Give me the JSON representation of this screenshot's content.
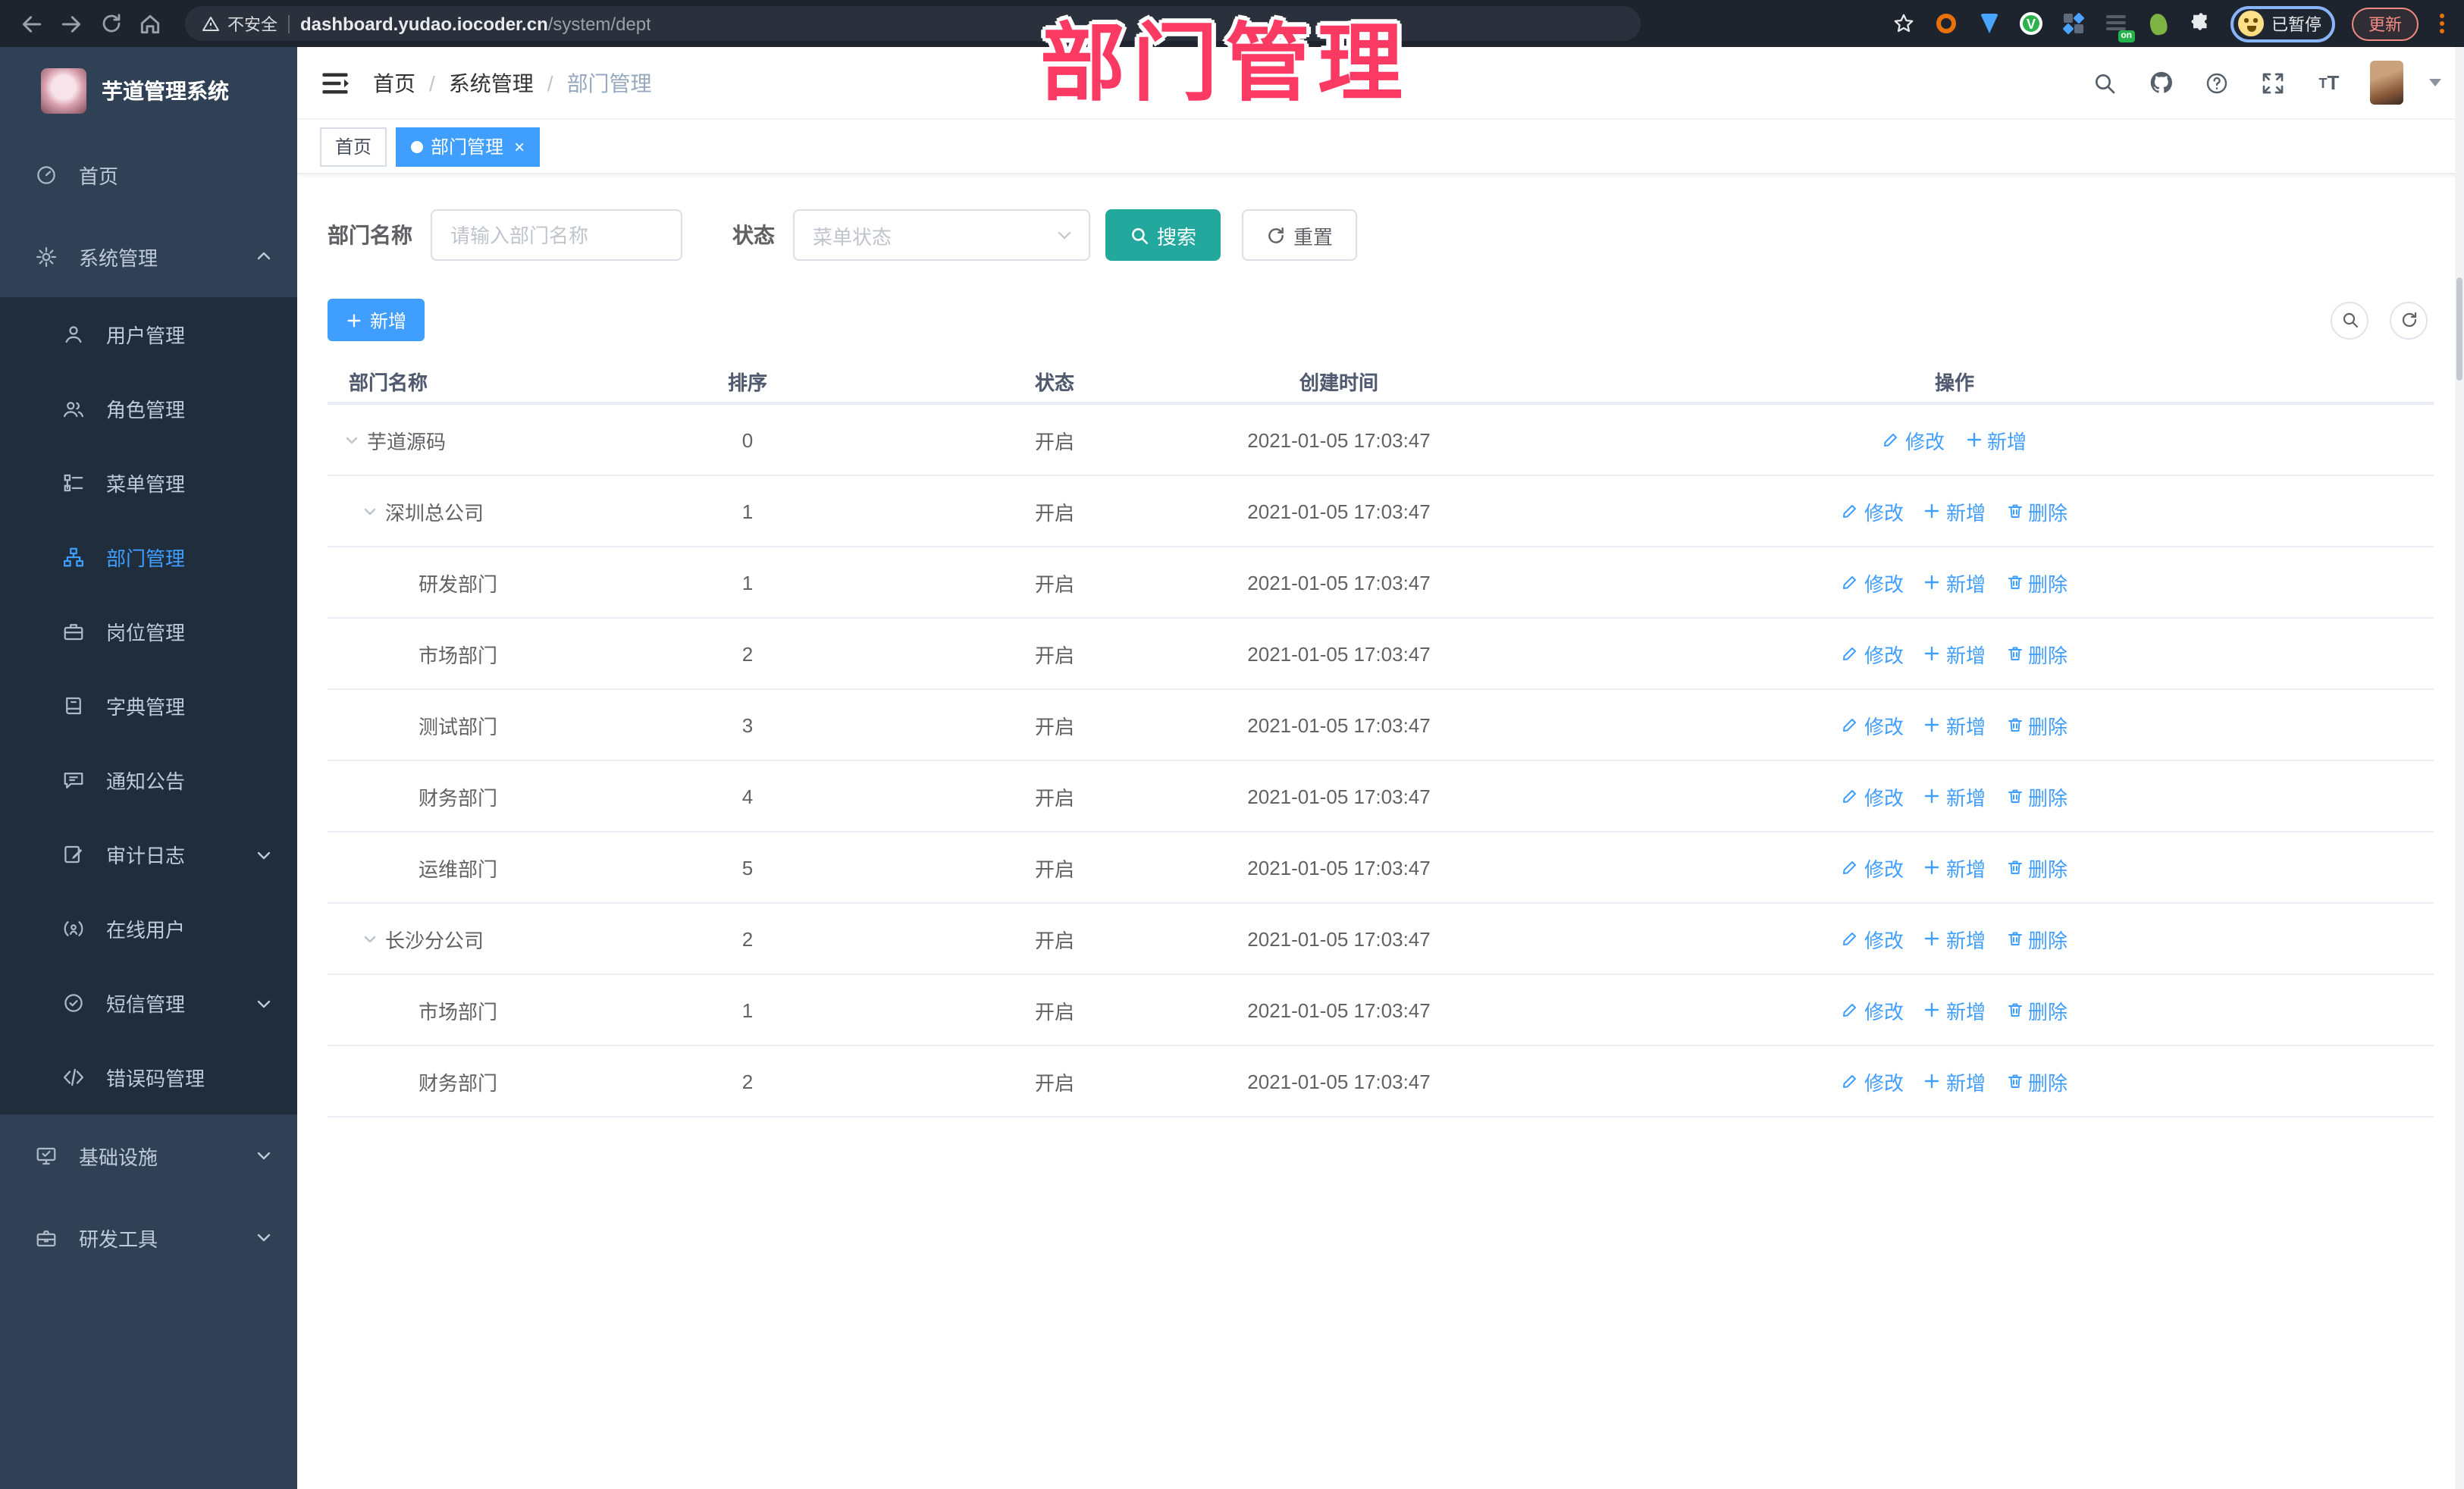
{
  "browser": {
    "security_label": "不安全",
    "url_domain": "dashboard.yudao.iocoder.cn",
    "url_path": "/system/dept",
    "extension_badge": "on",
    "profile_label": "已暂停",
    "update_label": "更新"
  },
  "watermark": "部门管理",
  "sidebar": {
    "title": "芋道管理系统",
    "items": [
      {
        "label": "首页"
      },
      {
        "label": "系统管理"
      },
      {
        "label": "用户管理"
      },
      {
        "label": "角色管理"
      },
      {
        "label": "菜单管理"
      },
      {
        "label": "部门管理"
      },
      {
        "label": "岗位管理"
      },
      {
        "label": "字典管理"
      },
      {
        "label": "通知公告"
      },
      {
        "label": "审计日志"
      },
      {
        "label": "在线用户"
      },
      {
        "label": "短信管理"
      },
      {
        "label": "错误码管理"
      },
      {
        "label": "基础设施"
      },
      {
        "label": "研发工具"
      }
    ]
  },
  "header": {
    "breadcrumb": [
      "首页",
      "系统管理",
      "部门管理"
    ]
  },
  "tabs": [
    {
      "label": "首页"
    },
    {
      "label": "部门管理"
    }
  ],
  "filters": {
    "dept_name_label": "部门名称",
    "dept_name_placeholder": "请输入部门名称",
    "status_label": "状态",
    "status_placeholder": "菜单状态",
    "search_label": "搜索",
    "reset_label": "重置"
  },
  "toolbar": {
    "add_label": "新增"
  },
  "table": {
    "columns": [
      "部门名称",
      "排序",
      "状态",
      "创建时间",
      "操作"
    ],
    "action_labels": {
      "edit": "修改",
      "add": "新增",
      "delete": "删除"
    },
    "rows": [
      {
        "name": "芋道源码",
        "level": 0,
        "caret": true,
        "sort": "0",
        "status": "开启",
        "time": "2021-01-05 17:03:47",
        "actions": [
          "edit",
          "add"
        ]
      },
      {
        "name": "深圳总公司",
        "level": 1,
        "caret": true,
        "sort": "1",
        "status": "开启",
        "time": "2021-01-05 17:03:47",
        "actions": [
          "edit",
          "add",
          "delete"
        ]
      },
      {
        "name": "研发部门",
        "level": 2,
        "caret": false,
        "sort": "1",
        "status": "开启",
        "time": "2021-01-05 17:03:47",
        "actions": [
          "edit",
          "add",
          "delete"
        ]
      },
      {
        "name": "市场部门",
        "level": 2,
        "caret": false,
        "sort": "2",
        "status": "开启",
        "time": "2021-01-05 17:03:47",
        "actions": [
          "edit",
          "add",
          "delete"
        ]
      },
      {
        "name": "测试部门",
        "level": 2,
        "caret": false,
        "sort": "3",
        "status": "开启",
        "time": "2021-01-05 17:03:47",
        "actions": [
          "edit",
          "add",
          "delete"
        ]
      },
      {
        "name": "财务部门",
        "level": 2,
        "caret": false,
        "sort": "4",
        "status": "开启",
        "time": "2021-01-05 17:03:47",
        "actions": [
          "edit",
          "add",
          "delete"
        ]
      },
      {
        "name": "运维部门",
        "level": 2,
        "caret": false,
        "sort": "5",
        "status": "开启",
        "time": "2021-01-05 17:03:47",
        "actions": [
          "edit",
          "add",
          "delete"
        ]
      },
      {
        "name": "长沙分公司",
        "level": 1,
        "caret": true,
        "sort": "2",
        "status": "开启",
        "time": "2021-01-05 17:03:47",
        "actions": [
          "edit",
          "add",
          "delete"
        ]
      },
      {
        "name": "市场部门",
        "level": 2,
        "caret": false,
        "sort": "1",
        "status": "开启",
        "time": "2021-01-05 17:03:47",
        "actions": [
          "edit",
          "add",
          "delete"
        ]
      },
      {
        "name": "财务部门",
        "level": 2,
        "caret": false,
        "sort": "2",
        "status": "开启",
        "time": "2021-01-05 17:03:47",
        "actions": [
          "edit",
          "add",
          "delete"
        ]
      }
    ]
  },
  "colors": {
    "accent": "#409eff",
    "search_button": "#23a89d",
    "watermark_pink": "#fb3a63",
    "sidebar_bg": "#304156",
    "submenu_bg": "#1f2d3d"
  }
}
